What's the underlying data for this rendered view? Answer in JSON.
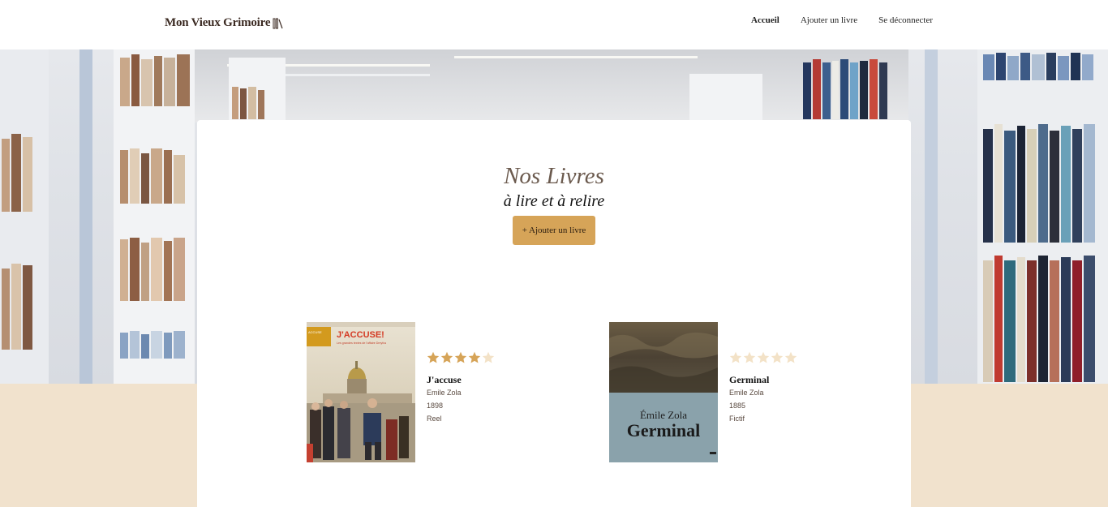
{
  "header": {
    "logo_text": "Mon Vieux Grimoire",
    "logo_icon": "books-icon",
    "nav": [
      {
        "label": "Accueil",
        "active": true
      },
      {
        "label": "Ajouter un livre",
        "active": false
      },
      {
        "label": "Se déconnecter",
        "active": false
      }
    ]
  },
  "main": {
    "title": "Nos Livres",
    "subtitle": "à lire et à relire",
    "add_button_label": "+ Ajouter un livre"
  },
  "books": [
    {
      "rating": 4,
      "rating_max": 5,
      "title": "J'accuse",
      "author": "Emile Zola",
      "year": "1898",
      "genre": "Reel",
      "cover": {
        "top_label": "J'ACCUSE!",
        "sub_label": "Les grandes textes de l'affaire Dreyfus",
        "badge": "ACCUSE"
      }
    },
    {
      "rating": 0,
      "rating_max": 5,
      "title": "Germinal",
      "author": "Emile Zola",
      "year": "1885",
      "genre": "Fictif",
      "cover": {
        "author": "Émile Zola",
        "title": "Germinal"
      }
    }
  ],
  "colors": {
    "accent": "#d6a458",
    "star_filled": "#d6a458",
    "star_empty": "#f3e2c7",
    "page_bg": "#f1e2cd",
    "title_color": "#6b5a4e"
  }
}
